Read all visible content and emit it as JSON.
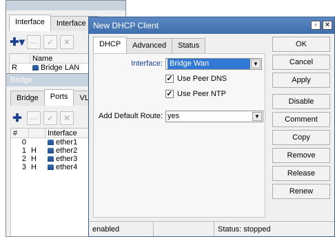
{
  "bg_window": {
    "tabs": [
      "Interface",
      "Interface L"
    ],
    "columns": [
      "Name"
    ],
    "row": {
      "flag": "R",
      "name": "Bridge LAN"
    }
  },
  "bridge_window": {
    "title": "Bridge",
    "tabs": [
      "Bridge",
      "Ports",
      "VLA"
    ],
    "columns": [
      "#",
      "Interface"
    ],
    "rows": [
      {
        "num": "0",
        "flag": "",
        "iface": "ether1"
      },
      {
        "num": "1",
        "flag": "H",
        "iface": "ether2"
      },
      {
        "num": "2",
        "flag": "H",
        "iface": "ether3"
      },
      {
        "num": "3",
        "flag": "H",
        "iface": "ether4"
      }
    ]
  },
  "dialog": {
    "title": "New DHCP Client",
    "tabs": [
      "DHCP",
      "Advanced",
      "Status"
    ],
    "interface_label": "Interface:",
    "interface_value": "Bridge Wan",
    "use_peer_dns": "Use Peer DNS",
    "use_peer_ntp": "Use Peer NTP",
    "default_route_label": "Add Default Route:",
    "default_route_value": "yes",
    "buttons": [
      "OK",
      "Cancel",
      "Apply",
      "Disable",
      "Comment",
      "Copy",
      "Remove",
      "Release",
      "Renew"
    ],
    "status_left": "enabled",
    "status_right": "Status: stopped"
  }
}
